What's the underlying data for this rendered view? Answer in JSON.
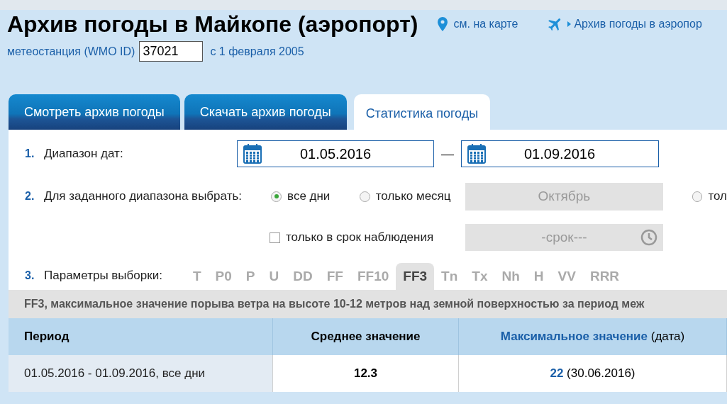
{
  "header": {
    "title": "Архив погоды в Майкопе (аэропорт)",
    "map_link": "см. на карте",
    "airport_link": "Архив погоды в аэропор"
  },
  "station": {
    "label": "метеостанция (WMO ID)",
    "wmo_id": "37021",
    "since": "с 1 февраля 2005"
  },
  "tabs": [
    {
      "label": "Смотреть архив погоды",
      "selected": false
    },
    {
      "label": "Скачать архив погоды",
      "selected": false
    },
    {
      "label": "Статистика погоды",
      "selected": true
    }
  ],
  "date_range": {
    "number": "1.",
    "label": "Диапазон дат:",
    "from": "01.05.2016",
    "separator": "—",
    "to": "01.09.2016"
  },
  "period_choice": {
    "number": "2.",
    "label": "Для заданного диапазона выбрать:",
    "options": [
      {
        "label": "все дни",
        "selected": true
      },
      {
        "label": "только месяц",
        "selected": false
      },
      {
        "label": "тол",
        "selected": false
      }
    ],
    "month": "Октябрь",
    "observation_time": {
      "label": "только в срок наблюдения",
      "checked": false
    },
    "time_select": "-срок---"
  },
  "parameters": {
    "number": "3.",
    "label": "Параметры выборки:",
    "items": [
      {
        "label": "T",
        "selected": false
      },
      {
        "label": "P0",
        "selected": false
      },
      {
        "label": "P",
        "selected": false
      },
      {
        "label": "U",
        "selected": false
      },
      {
        "label": "DD",
        "selected": false
      },
      {
        "label": "FF",
        "selected": false
      },
      {
        "label": "FF10",
        "selected": false
      },
      {
        "label": "FF3",
        "selected": true
      },
      {
        "label": "Tn",
        "selected": false
      },
      {
        "label": "Tx",
        "selected": false
      },
      {
        "label": "Nh",
        "selected": false
      },
      {
        "label": "H",
        "selected": false
      },
      {
        "label": "VV",
        "selected": false
      },
      {
        "label": "RRR",
        "selected": false
      }
    ]
  },
  "description": "FF3, максимальное значение порыва ветра на высоте 10-12 метров над земной поверхностью за период меж",
  "table": {
    "columns": [
      "Период",
      "Среднее значение",
      "**Максимальное значение** (дата)"
    ],
    "rows": [
      [
        "01.05.2016 - 01.09.2016, все дни",
        "12.3",
        "22 (30.06.2016)"
      ]
    ]
  }
}
